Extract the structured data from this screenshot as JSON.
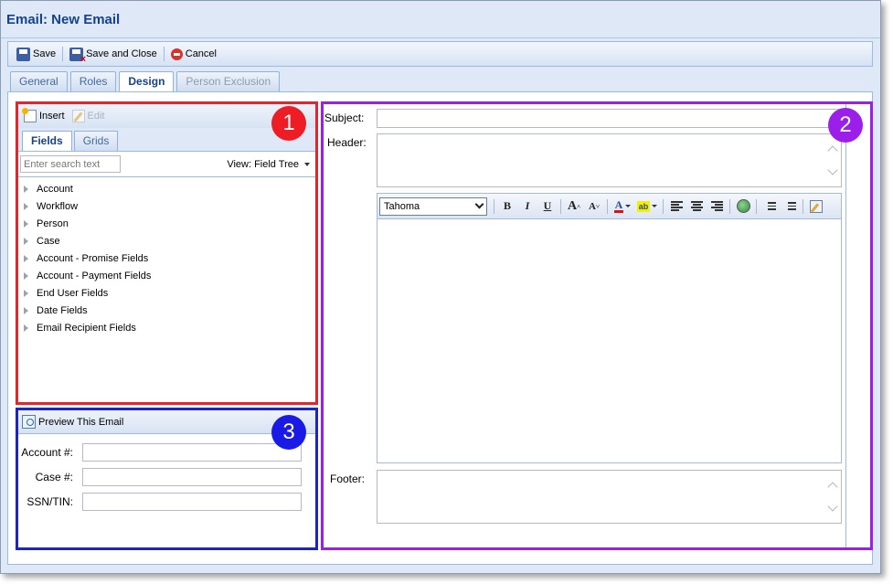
{
  "window": {
    "title": "Email: New Email"
  },
  "toolbar": {
    "save_label": "Save",
    "save_close_label": "Save and Close",
    "cancel_label": "Cancel"
  },
  "tabs": [
    {
      "label": "General",
      "state": "normal"
    },
    {
      "label": "Roles",
      "state": "normal"
    },
    {
      "label": "Design",
      "state": "active"
    },
    {
      "label": "Person Exclusion",
      "state": "disabled"
    }
  ],
  "fields_panel": {
    "badge": "1",
    "insert_label": "Insert",
    "edit_label": "Edit",
    "tabs": [
      {
        "label": "Fields",
        "active": true
      },
      {
        "label": "Grids",
        "active": false
      }
    ],
    "search_placeholder": "Enter search text",
    "view_label": "View: Field Tree",
    "tree": [
      "Account",
      "Workflow",
      "Person",
      "Case",
      "Account - Promise Fields",
      "Account - Payment Fields",
      "End User Fields",
      "Date Fields",
      "Email Recipient Fields"
    ]
  },
  "preview_panel": {
    "badge": "3",
    "title": "Preview This Email",
    "fields": [
      {
        "label": "Account #:",
        "value": ""
      },
      {
        "label": "Case #:",
        "value": ""
      },
      {
        "label": "SSN/TIN:",
        "value": ""
      }
    ]
  },
  "editor_panel": {
    "badge": "2",
    "subject_label": "Subject:",
    "subject_value": "",
    "header_label": "Header:",
    "footer_label": "Footer:",
    "font_value": "Tahoma",
    "buttons": [
      "bold",
      "italic",
      "underline",
      "grow-font",
      "shrink-font",
      "font-color",
      "highlight",
      "align-left",
      "align-center",
      "align-right",
      "insert-image",
      "ordered-list",
      "unordered-list",
      "source-edit"
    ]
  },
  "colors": {
    "panel1_border": "#e8232b",
    "panel2_border": "#9b1fe8",
    "panel3_border": "#1b24c4",
    "accent_title": "#15428b"
  }
}
